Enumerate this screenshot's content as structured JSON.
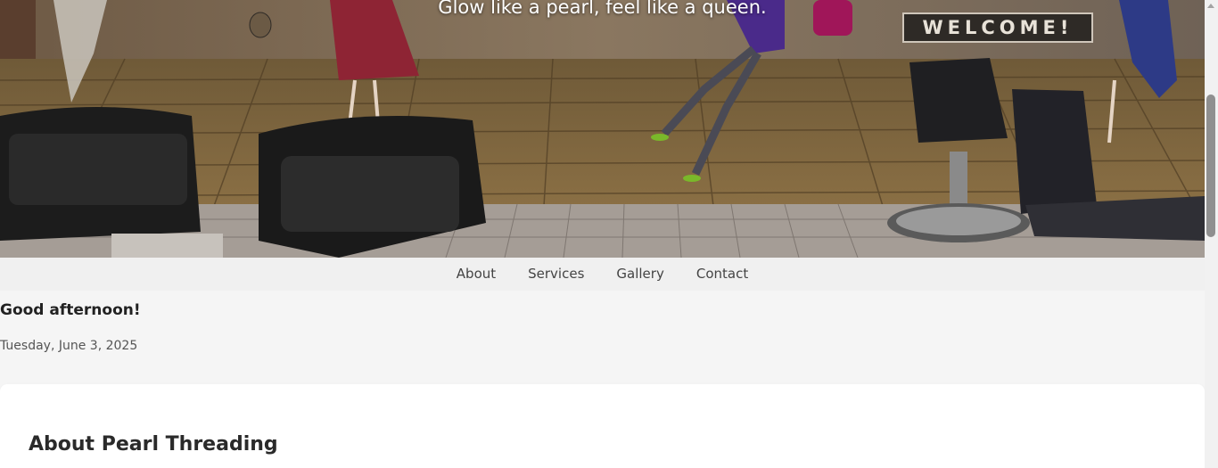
{
  "hero": {
    "tagline": "Glow like a pearl, feel like a queen.",
    "sign_text": "WELCOME!"
  },
  "nav": {
    "items": [
      {
        "label": "About"
      },
      {
        "label": "Services"
      },
      {
        "label": "Gallery"
      },
      {
        "label": "Contact"
      }
    ]
  },
  "greeting": {
    "message": "Good afternoon!",
    "date": "Tuesday, June 3, 2025"
  },
  "about": {
    "title": "About Pearl Threading"
  }
}
